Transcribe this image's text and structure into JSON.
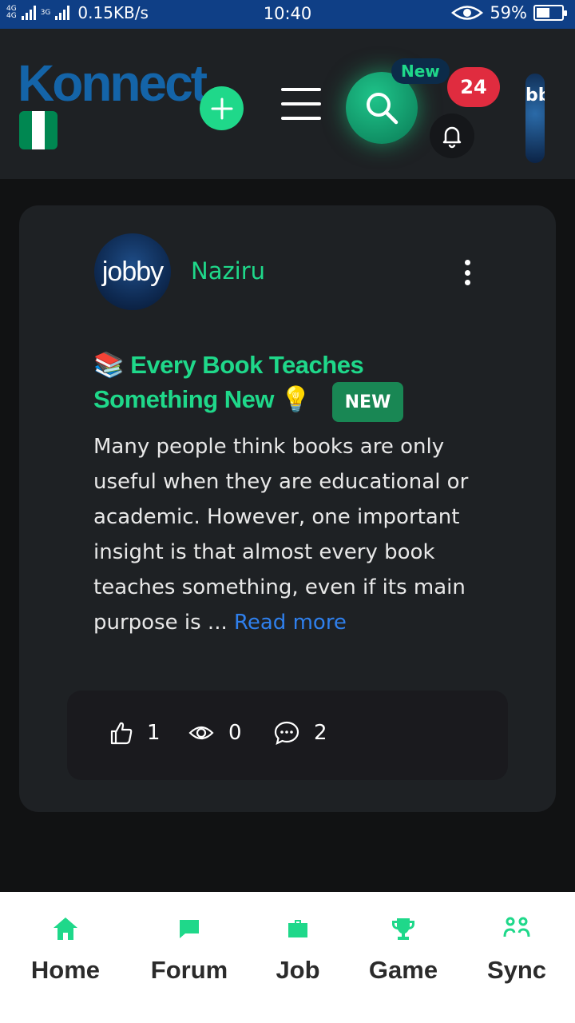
{
  "status_bar": {
    "net_a": "4G",
    "net_b": "4G",
    "net_c": "3G",
    "speed": "0.15KB/s",
    "time": "10:40",
    "battery": "59%",
    "battery_level": 0.59
  },
  "header": {
    "logo": "Konnect",
    "new_label": "New",
    "notification_count": "24",
    "avatar_text": "bb",
    "flag_colors": [
      "#008751",
      "#ffffff",
      "#008751"
    ]
  },
  "post": {
    "avatar_text": "jobby",
    "author": "Naziru",
    "title_emoji_start": "📚",
    "title": "Every Book Teaches Something New",
    "title_emoji_end": "💡",
    "badge": "NEW",
    "excerpt": "Many people think books are only useful when they are educational or academic. However, one important insight is that almost every book teaches something, even if its main purpose is ...",
    "read_more": "Read more",
    "stats": {
      "likes": "1",
      "views": "0",
      "comments": "2"
    }
  },
  "bottom_nav": {
    "items": [
      {
        "label": "Home",
        "icon": "home-icon"
      },
      {
        "label": "Forum",
        "icon": "chat-icon"
      },
      {
        "label": "Job",
        "icon": "briefcase-icon"
      },
      {
        "label": "Game",
        "icon": "trophy-icon"
      },
      {
        "label": "Sync",
        "icon": "people-icon"
      }
    ]
  },
  "colors": {
    "accent": "#1fd88a",
    "link": "#2f80ed",
    "badge_red": "#e02c3f",
    "status_bar": "#0f3f86"
  }
}
